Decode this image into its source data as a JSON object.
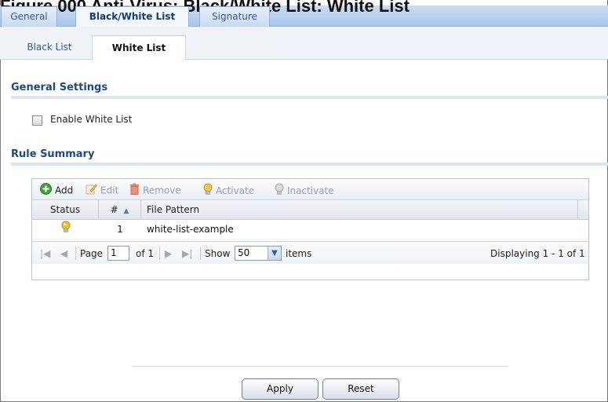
{
  "page_heading": "Figure 000 Anti-Virus: Black/White List: White List",
  "top_tabs": [
    {
      "label": "General"
    },
    {
      "label": "Black/White List"
    },
    {
      "label": "Signature"
    }
  ],
  "sub_tabs": [
    {
      "label": "Black List"
    },
    {
      "label": "White List"
    }
  ],
  "general_settings": {
    "title": "General Settings",
    "enable_label": "Enable White List",
    "enable_checked": false
  },
  "rule_summary": {
    "title": "Rule Summary",
    "toolbar": {
      "add": "Add",
      "edit": "Edit",
      "remove": "Remove",
      "activate": "Activate",
      "inactivate": "Inactivate"
    },
    "columns": {
      "status": "Status",
      "number": "#",
      "file_pattern": "File Pattern"
    },
    "rows": [
      {
        "status_icon": "lightbulb-on-icon",
        "number": "1",
        "file_pattern": "white-list-example"
      }
    ],
    "pager": {
      "page_label": "Page",
      "page_value": "1",
      "of_label": "of 1",
      "show_label": "Show",
      "page_size": "50",
      "items_label": "items",
      "displaying": "Displaying 1 - 1 of 1"
    }
  },
  "buttons": {
    "apply": "Apply",
    "reset": "Reset"
  },
  "colors": {
    "section_title": "#1d4a7e",
    "tab_bar": "#aac6ea",
    "active_bulb": "#f2c12e"
  }
}
